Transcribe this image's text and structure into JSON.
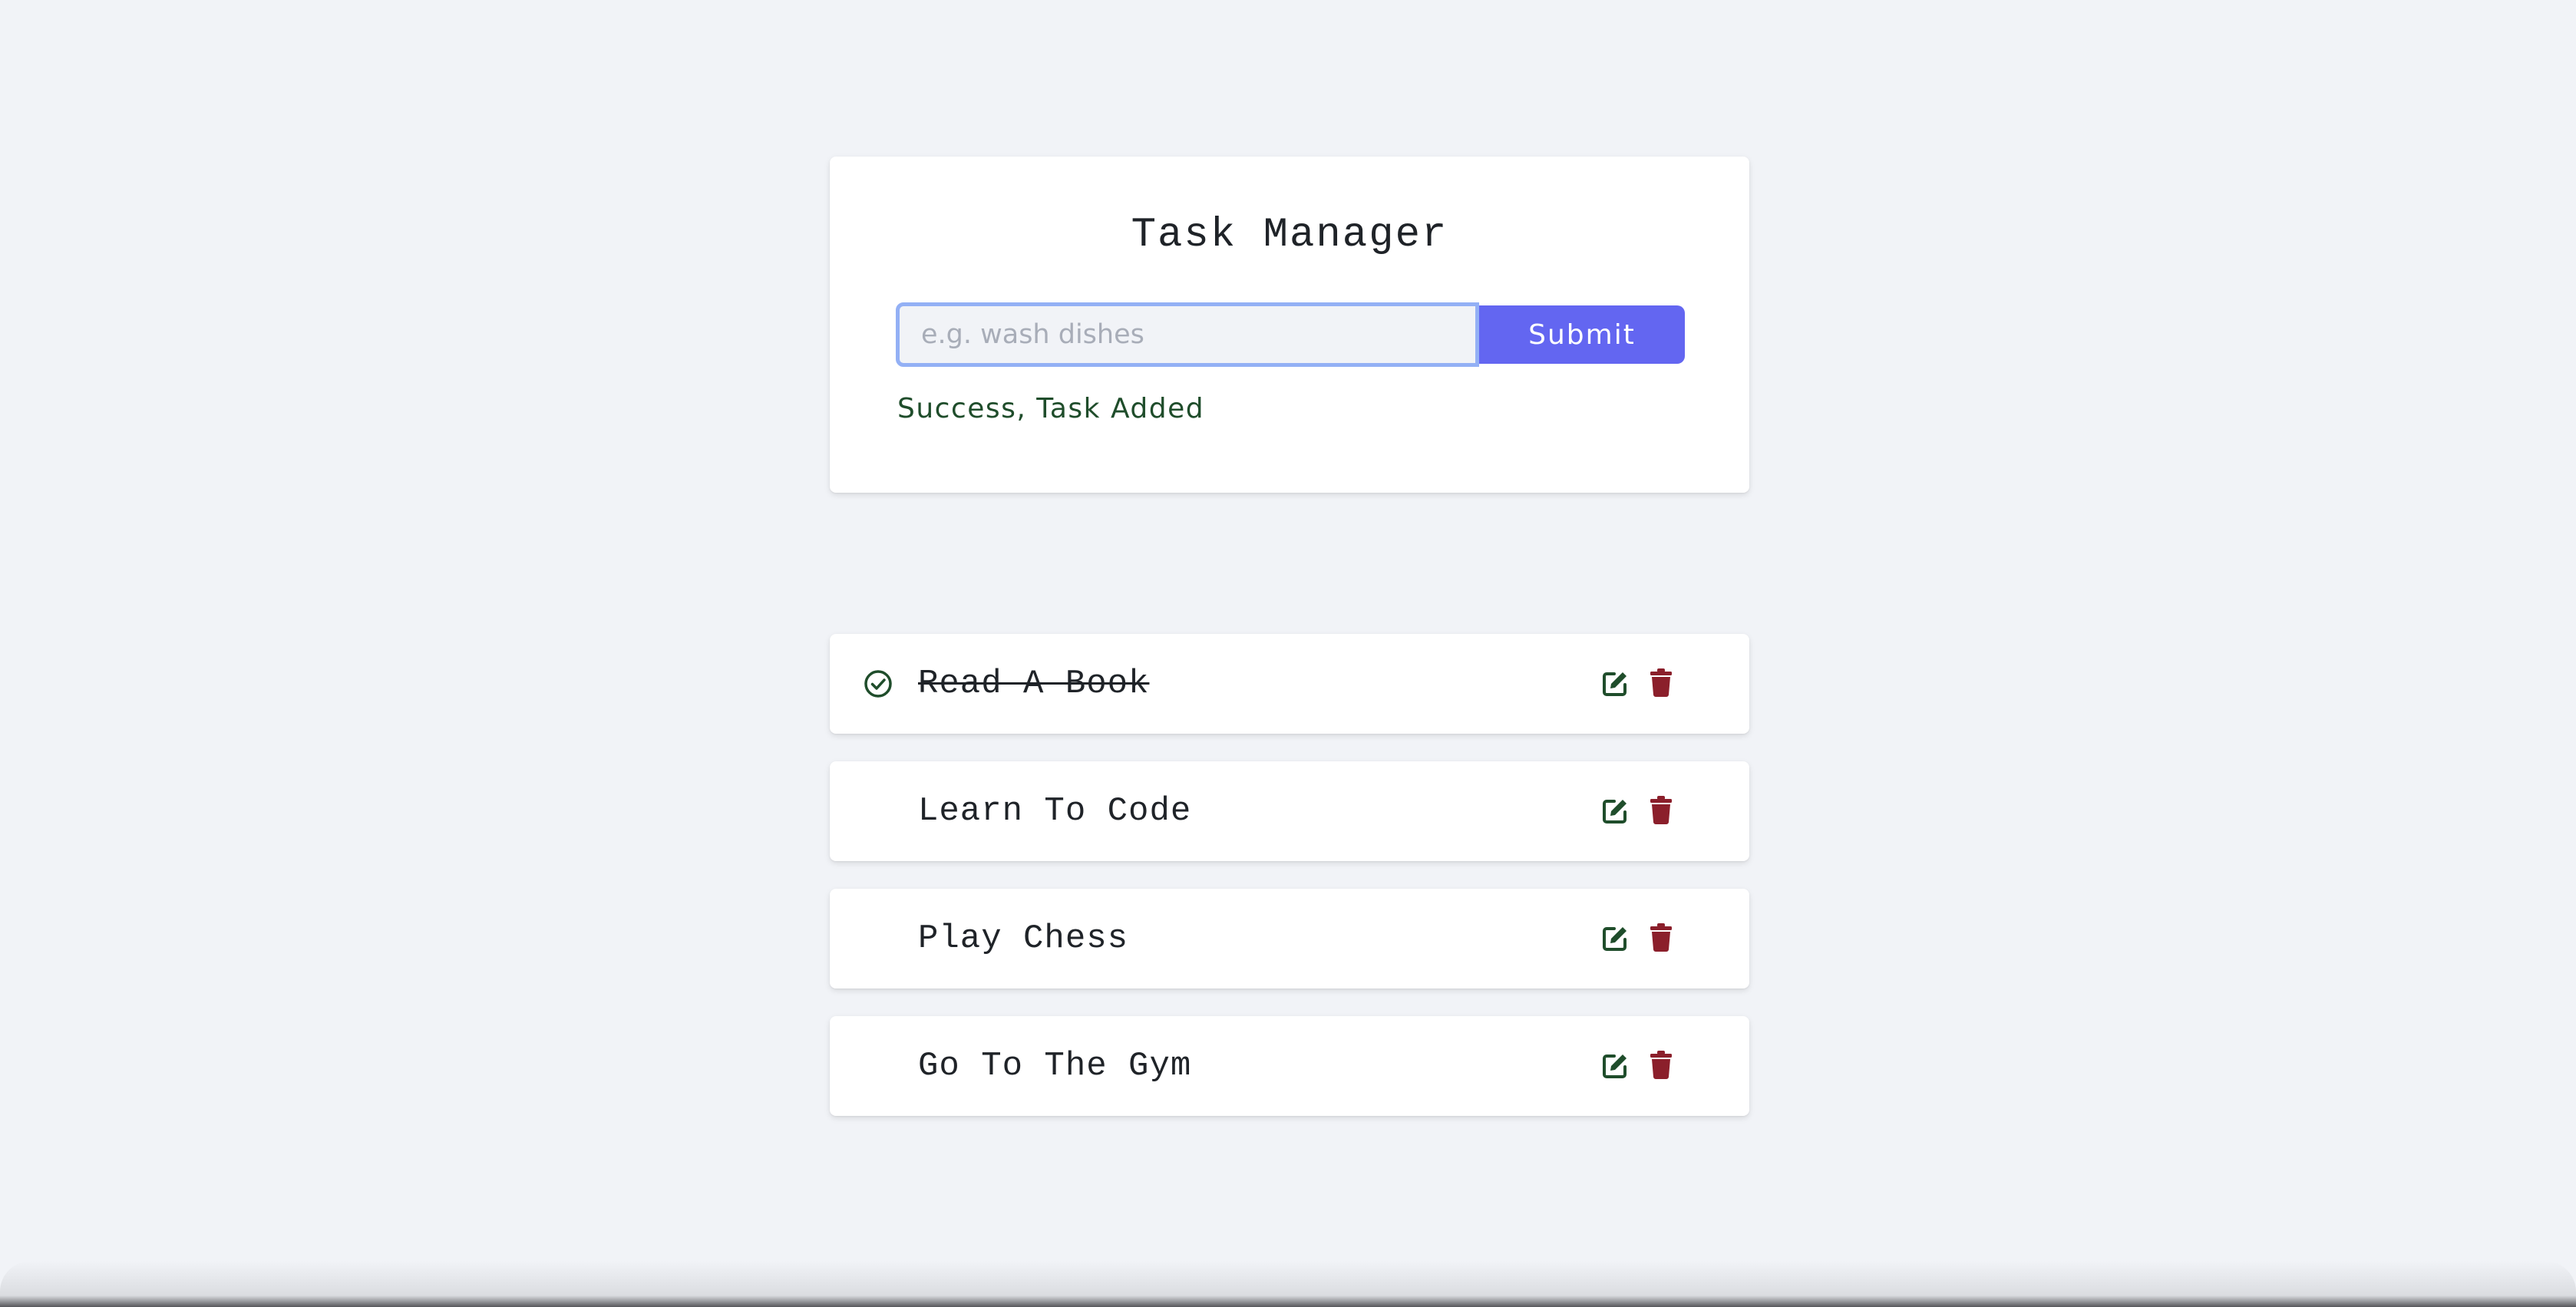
{
  "app": {
    "title": "Task Manager"
  },
  "form": {
    "input_placeholder": "e.g. wash dishes",
    "input_value": "",
    "submit_label": "Submit",
    "alert_text": "Success, Task Added"
  },
  "tasks": [
    {
      "name": "Read A Book",
      "completed": true
    },
    {
      "name": "Learn To Code",
      "completed": false
    },
    {
      "name": "Play Chess",
      "completed": false
    },
    {
      "name": "Go To The Gym",
      "completed": false
    }
  ],
  "icons": {
    "completed": "check-circle-icon",
    "edit": "edit-icon",
    "delete": "trash-icon"
  },
  "colors": {
    "background": "#f1f3f7",
    "accent": "#6366f1",
    "input_focus_border": "#93b0f5",
    "success_text": "#1f4d2b",
    "edit_icon": "#1f4d2b",
    "delete_icon": "#8b1f2b"
  }
}
